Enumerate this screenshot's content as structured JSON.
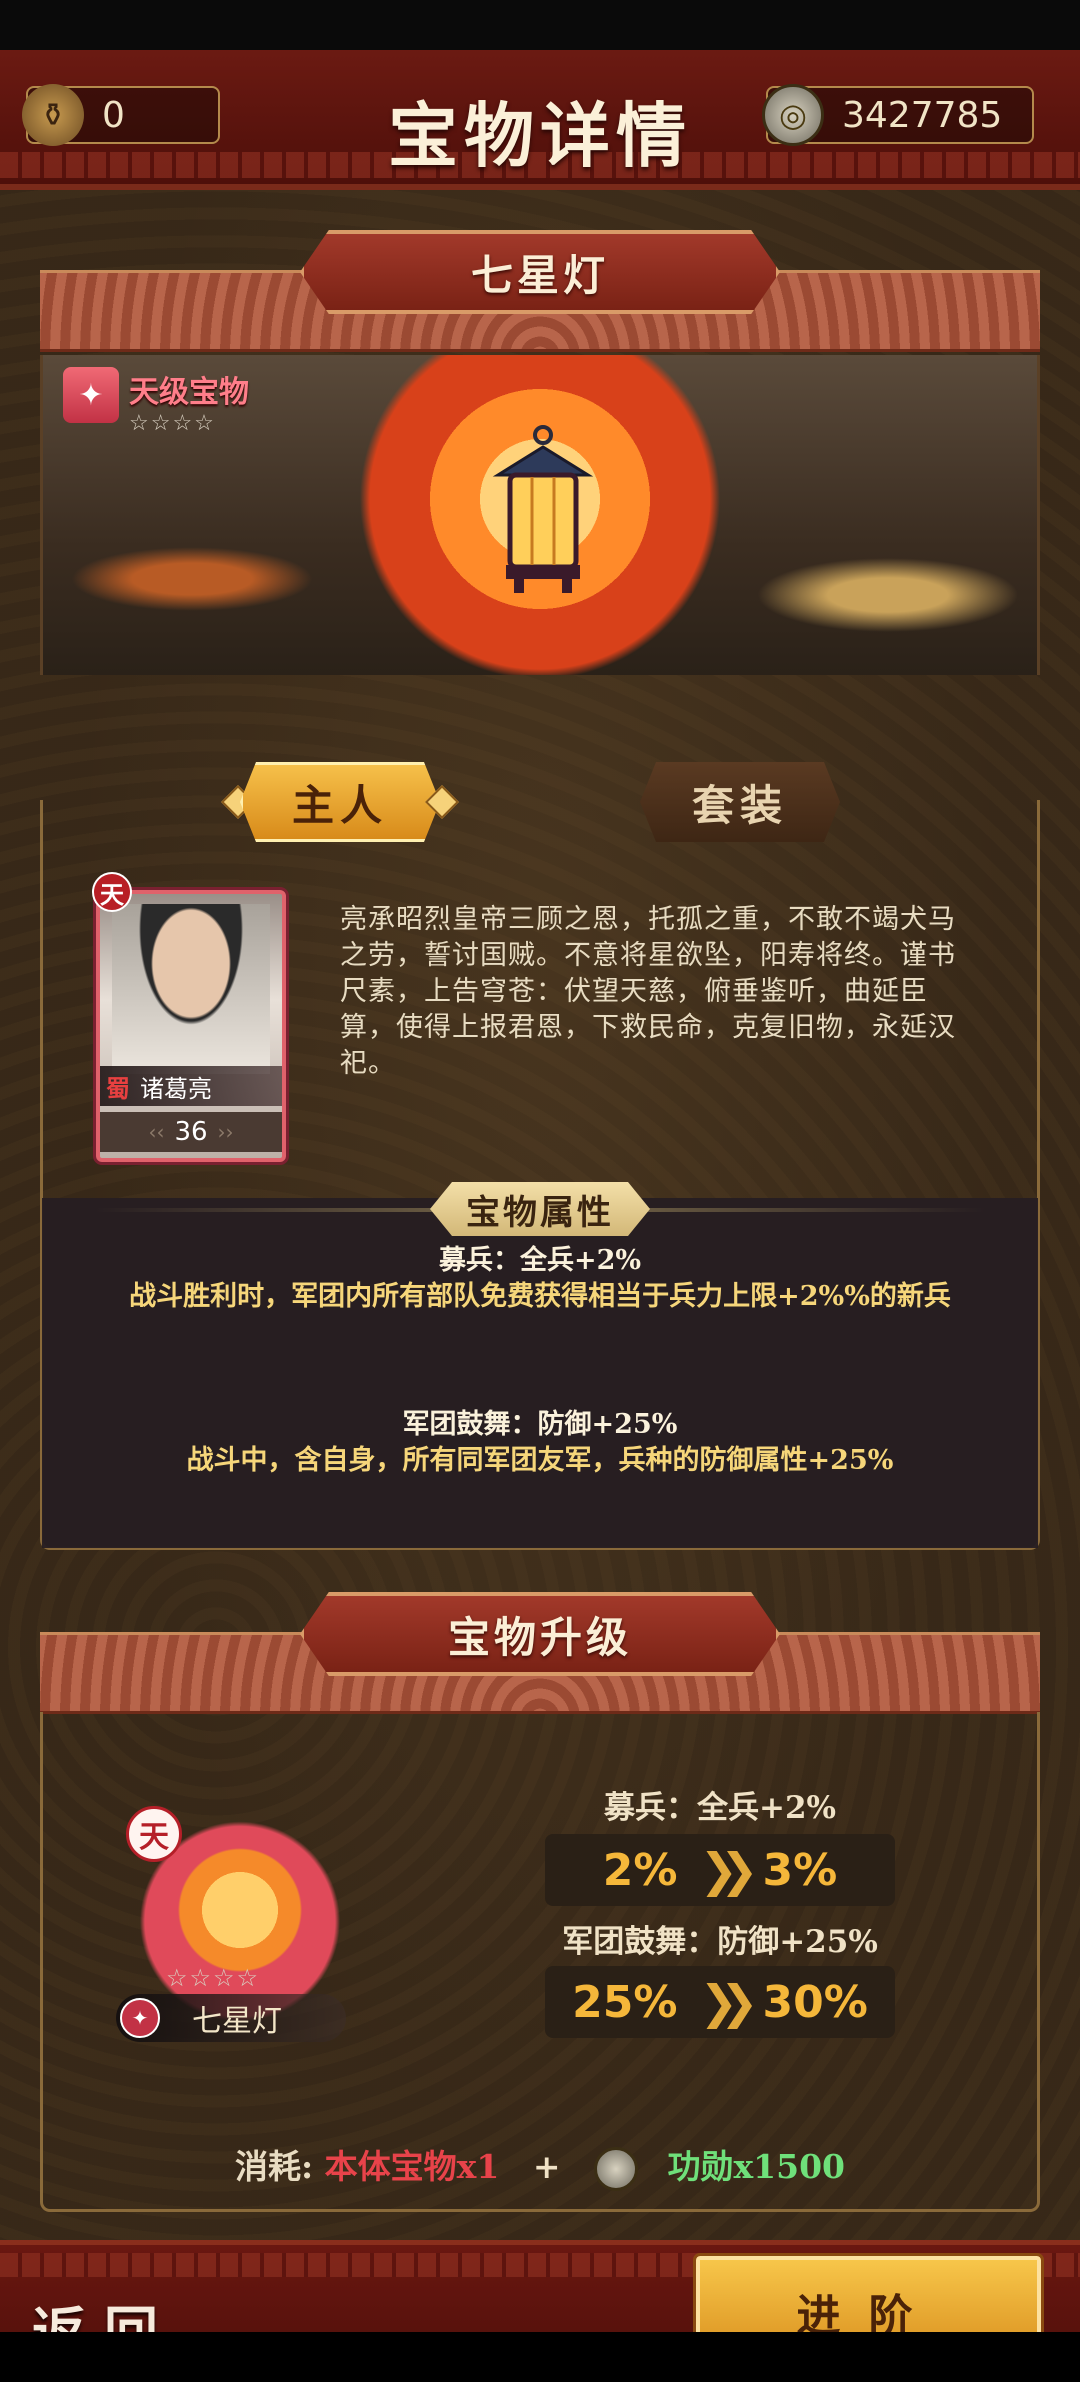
{
  "header": {
    "title": "宝物详情",
    "left_resource": {
      "icon": "magic-lamp-icon",
      "value": "0"
    },
    "right_resource": {
      "icon": "merit-coin-icon",
      "value": "3427785"
    }
  },
  "treasure": {
    "name": "七星灯",
    "grade": "天级宝物",
    "grade_icon": "treasure-grade-icon",
    "stars": "☆☆☆☆"
  },
  "tabs": [
    {
      "label": "主人",
      "active": true
    },
    {
      "label": "套装",
      "active": false
    }
  ],
  "owner": {
    "rank_badge": "天",
    "faction": "蜀",
    "name": "诸葛亮",
    "level": "36",
    "bio": "亮承昭烈皇帝三顾之恩，托孤之重，不敢不竭犬马之劳，誓讨国贼。不意将星欲坠，阳寿将终。谨书尺素，上告穹苍：伏望天慈，俯垂鉴听，曲延臣算，使得上报君恩，下救民命，克复旧物，永延汉祀。"
  },
  "attributes": {
    "title": "宝物属性",
    "items": [
      {
        "head": "募兵：全兵+2%",
        "desc": "战斗胜利时，军团内所有部队免费获得相当于兵力上限+2%%的新兵"
      },
      {
        "head": "军团鼓舞：防御+25%",
        "desc": "战斗中，含自身，所有同军团友军，兵种的防御属性+25%"
      }
    ]
  },
  "upgrade": {
    "title": "宝物升级",
    "treasure_rank": "天",
    "treasure_name": "七星灯",
    "stars": "☆☆☆☆",
    "rows": [
      {
        "label": "募兵：全兵+2%",
        "from": "2%",
        "to": "3%"
      },
      {
        "label": "军团鼓舞：防御+25%",
        "from": "25%",
        "to": "30%"
      }
    ],
    "cost": {
      "label": "消耗:",
      "item": "本体宝物x1",
      "plus": "+",
      "currency": "功勋x1500"
    }
  },
  "footer": {
    "back": "返回",
    "advance": "进阶"
  }
}
